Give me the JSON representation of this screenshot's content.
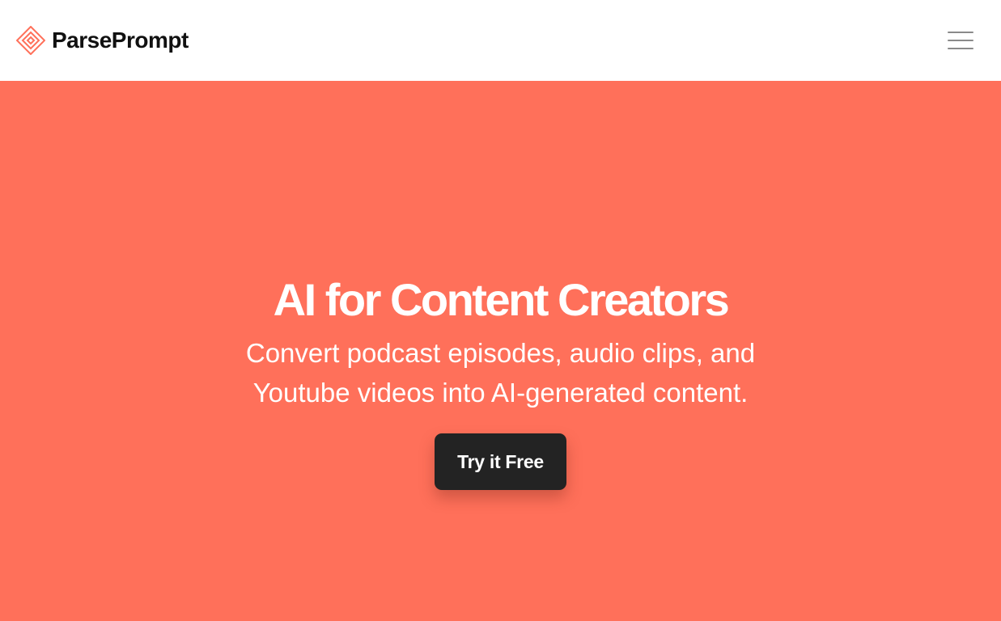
{
  "header": {
    "brand_name": "ParsePrompt",
    "logo_icon": "layered-diamond-logo-icon",
    "menu_icon": "hamburger-menu-icon"
  },
  "hero": {
    "title": "AI for Content Creators",
    "subtitle": "Convert podcast episodes, audio clips, and Youtube videos into AI-generated content.",
    "cta_label": "Try it Free"
  },
  "colors": {
    "hero_background": "#ff705a",
    "logo_accent": "#ff705a",
    "cta_background": "#232323",
    "text_on_hero": "#ffffff",
    "brand_text": "#111111"
  }
}
